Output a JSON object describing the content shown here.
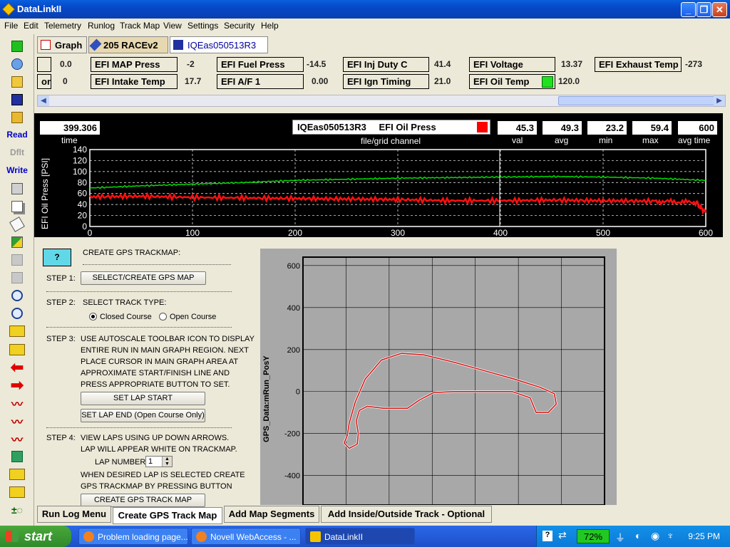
{
  "window": {
    "title": "DataLinkII"
  },
  "menu": [
    "File",
    "Edit",
    "Telemetry",
    "Runlog",
    "Track Map",
    "View",
    "Settings",
    "Security",
    "Help"
  ],
  "left_toolbar": {
    "read_label": "Read",
    "dflt_label": "Dflt",
    "write_label": "Write"
  },
  "top_tabs": [
    {
      "label": "Graph"
    },
    {
      "label": "205 RACEv2"
    },
    {
      "label": "IQEas050513R3"
    }
  ],
  "channels": {
    "row1": [
      {
        "name": "",
        "value": "0.0"
      },
      {
        "name": "EFI MAP Press",
        "value": "-2"
      },
      {
        "name": "EFI Fuel Press",
        "value": "-14.5"
      },
      {
        "name": "EFI Inj Duty C",
        "value": "41.4"
      },
      {
        "name": "EFI Voltage",
        "value": "13.37"
      },
      {
        "name": "EFI Exhaust Temp",
        "value": "-273"
      }
    ],
    "row2": [
      {
        "name": "on",
        "value": "0"
      },
      {
        "name": "EFI Intake Temp",
        "value": "17.7"
      },
      {
        "name": "EFI A/F 1",
        "value": "0.00"
      },
      {
        "name": "EFI Ign Timing",
        "value": "21.0"
      },
      {
        "name": "EFI Oil Temp",
        "value": "120.0"
      }
    ]
  },
  "graph": {
    "time_value": "399.306",
    "time_label": "time",
    "file": "IQEas050513R3",
    "channel": "EFI Oil Press",
    "filechan_label": "file/grid channel",
    "stats": [
      {
        "label": "val",
        "value": "45.3"
      },
      {
        "label": "avg",
        "value": "49.3"
      },
      {
        "label": "min",
        "value": "23.2"
      },
      {
        "label": "max",
        "value": "59.4"
      },
      {
        "label": "avg time",
        "value": "600"
      }
    ]
  },
  "chart_data": [
    {
      "type": "line",
      "ylabel": "EFI Oil Press [PSI]",
      "xlim": [
        0,
        600
      ],
      "ylim": [
        0,
        140
      ],
      "x_ticks": [
        "0",
        "100",
        "200",
        "300",
        "400",
        "500",
        "600"
      ],
      "y_ticks": [
        "0",
        "20",
        "40",
        "60",
        "80",
        "100",
        "120",
        "140"
      ],
      "grid": true,
      "cursor_x": 399.306,
      "series": [
        {
          "color": "#00e000",
          "x": [
            0,
            50,
            100,
            150,
            200,
            250,
            300,
            350,
            400,
            450,
            500,
            550,
            600
          ],
          "y": [
            70,
            74,
            77,
            80,
            84,
            86,
            88,
            89,
            90,
            91,
            90,
            88,
            84
          ]
        },
        {
          "color": "#ff1010",
          "x": [
            0,
            50,
            100,
            150,
            200,
            250,
            300,
            350,
            400,
            450,
            500,
            550,
            590,
            600
          ],
          "y": [
            54,
            55,
            53,
            52,
            51,
            50,
            49,
            47,
            47,
            48,
            47,
            46,
            44,
            25
          ]
        }
      ]
    },
    {
      "type": "scatter",
      "ylabel": "GPS_Data:mRun_PosY",
      "y_ticks": [
        "600",
        "400",
        "200",
        "0",
        "-200",
        "-400"
      ],
      "ylim": [
        -540,
        640
      ],
      "xlim": [
        -600,
        900
      ],
      "grid": true
    }
  ],
  "steps": {
    "help_icon": "question-icon",
    "heading": "CREATE GPS TRACKMAP:",
    "step1_label": "STEP 1:",
    "step1_button": "SELECT/CREATE  GPS MAP",
    "step2_label": "STEP 2:",
    "step2_text": "SELECT TRACK TYPE:",
    "closed_course": "Closed Course",
    "open_course": "Open Course",
    "step3_label": "STEP 3:",
    "step3_lines": [
      "USE AUTOSCALE TOOLBAR ICON TO DISPLAY",
      "ENTIRE RUN IN MAIN GRAPH REGION. NEXT",
      "PLACE CURSOR IN MAIN GRAPH AREA AT",
      "APPROXIMATE START/FINISH LINE  AND",
      "PRESS APPROPRIATE BUTTON TO SET."
    ],
    "set_lap_start": "SET LAP START",
    "set_lap_end": "SET LAP END (Open Course Only)",
    "step4_label": "STEP 4:",
    "step4_lines": [
      "VIEW LAPS USING UP DOWN ARROWS.",
      "LAP WILL APPEAR WHITE ON TRACKMAP."
    ],
    "lap_number_label": "LAP NUMBER:",
    "lap_number_value": "1",
    "step4_lines2": [
      "WHEN DESIRED LAP IS SELECTED CREATE",
      "GPS TRACKMAP BY PRESSING BUTTON"
    ],
    "create_button": "CREATE GPS TRACK MAP"
  },
  "bottom_tabs": [
    {
      "label": "Run Log Menu"
    },
    {
      "label": "Create GPS Track Map"
    },
    {
      "label": "Add Map Segments"
    },
    {
      "label": "Add Inside/Outside Track - Optional"
    }
  ],
  "taskbar": {
    "start": "start",
    "tasks": [
      {
        "label": "Problem loading page..."
      },
      {
        "label": "Novell WebAccess - ..."
      },
      {
        "label": "DataLinkII"
      }
    ],
    "battery": "72%",
    "clock": "9:25 PM"
  }
}
